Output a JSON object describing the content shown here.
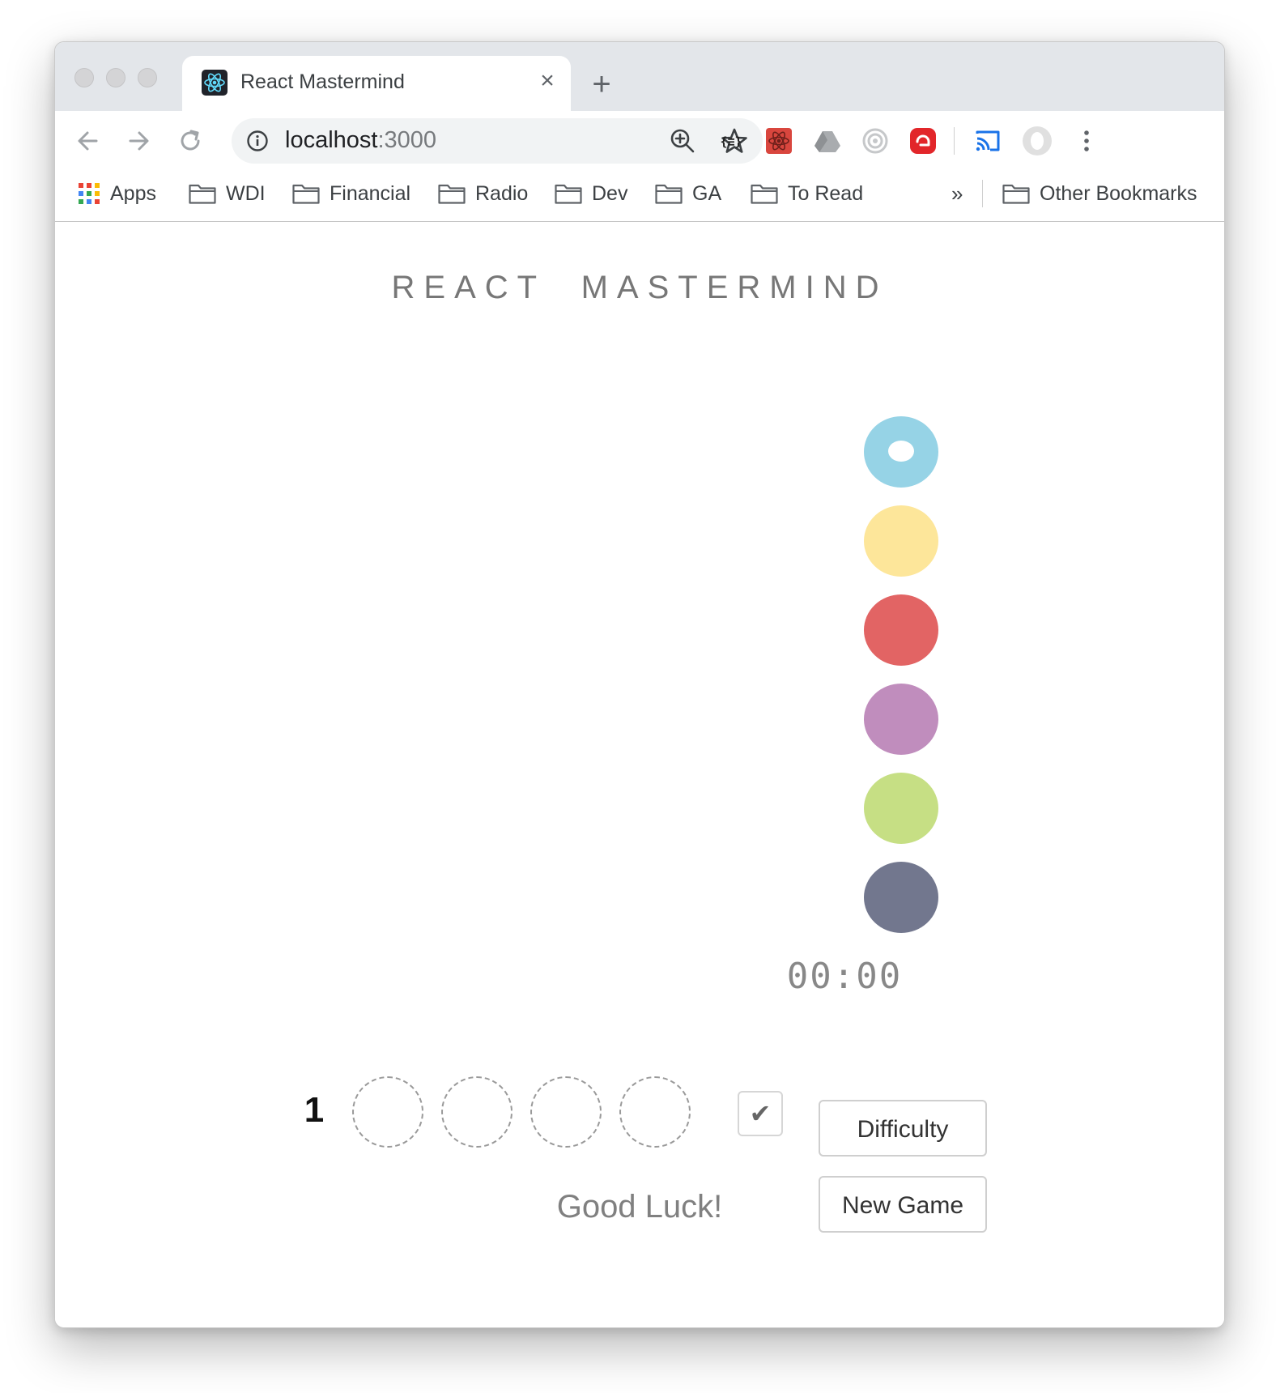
{
  "browser": {
    "tab_title": "React Mastermind",
    "tab_close": "×",
    "new_tab": "+",
    "url_host": "localhost",
    "url_port": ":3000"
  },
  "bookmarks": {
    "items": [
      "Apps",
      "WDI",
      "Financial",
      "Radio",
      "Dev",
      "GA",
      "To Read"
    ],
    "overflow": "»",
    "other": "Other Bookmarks"
  },
  "game": {
    "title": "REACT  MASTERMIND",
    "palette": [
      {
        "name": "blue",
        "color": "#96d3e6",
        "selected": true
      },
      {
        "name": "yellow",
        "color": "#fde69a"
      },
      {
        "name": "red",
        "color": "#e26464"
      },
      {
        "name": "purple",
        "color": "#c08dbd"
      },
      {
        "name": "green",
        "color": "#c6df84"
      },
      {
        "name": "slate",
        "color": "#72778e"
      }
    ],
    "timer": "00:00",
    "difficulty_label": "Difficulty",
    "new_game_label": "New Game",
    "row_number": "1",
    "check_symbol": "✔",
    "message": "Good Luck!"
  }
}
